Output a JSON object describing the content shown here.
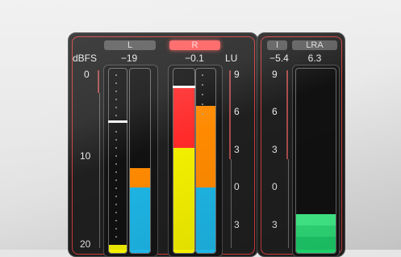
{
  "colors": {
    "panel": "#1f1f1f",
    "border_red": "#cc3a3a",
    "yellow": "#f4f000",
    "cyan": "#1eb6e6",
    "orange": "#ff8a00",
    "red": "#ff2a2a",
    "green": "#43f28c"
  },
  "labels": {
    "l_channel": "L",
    "r_channel": "R",
    "dbfs": "dBFS",
    "lu": "LU",
    "i": "I",
    "lra": "LRA"
  },
  "values": {
    "l_value": "−19",
    "r_value": "−0.1",
    "i_value": "−5.4",
    "lra_value": "6.3"
  },
  "dbfs_scale": [
    "0",
    "10",
    "20"
  ],
  "lu_scale": [
    "9",
    "6",
    "3",
    "0",
    "3"
  ],
  "lra_scale": [
    "9",
    "6",
    "3",
    "0",
    "3"
  ],
  "levels_note": {
    "l_peak_dbfs": -19,
    "r_peak_dbfs": -0.1
  }
}
